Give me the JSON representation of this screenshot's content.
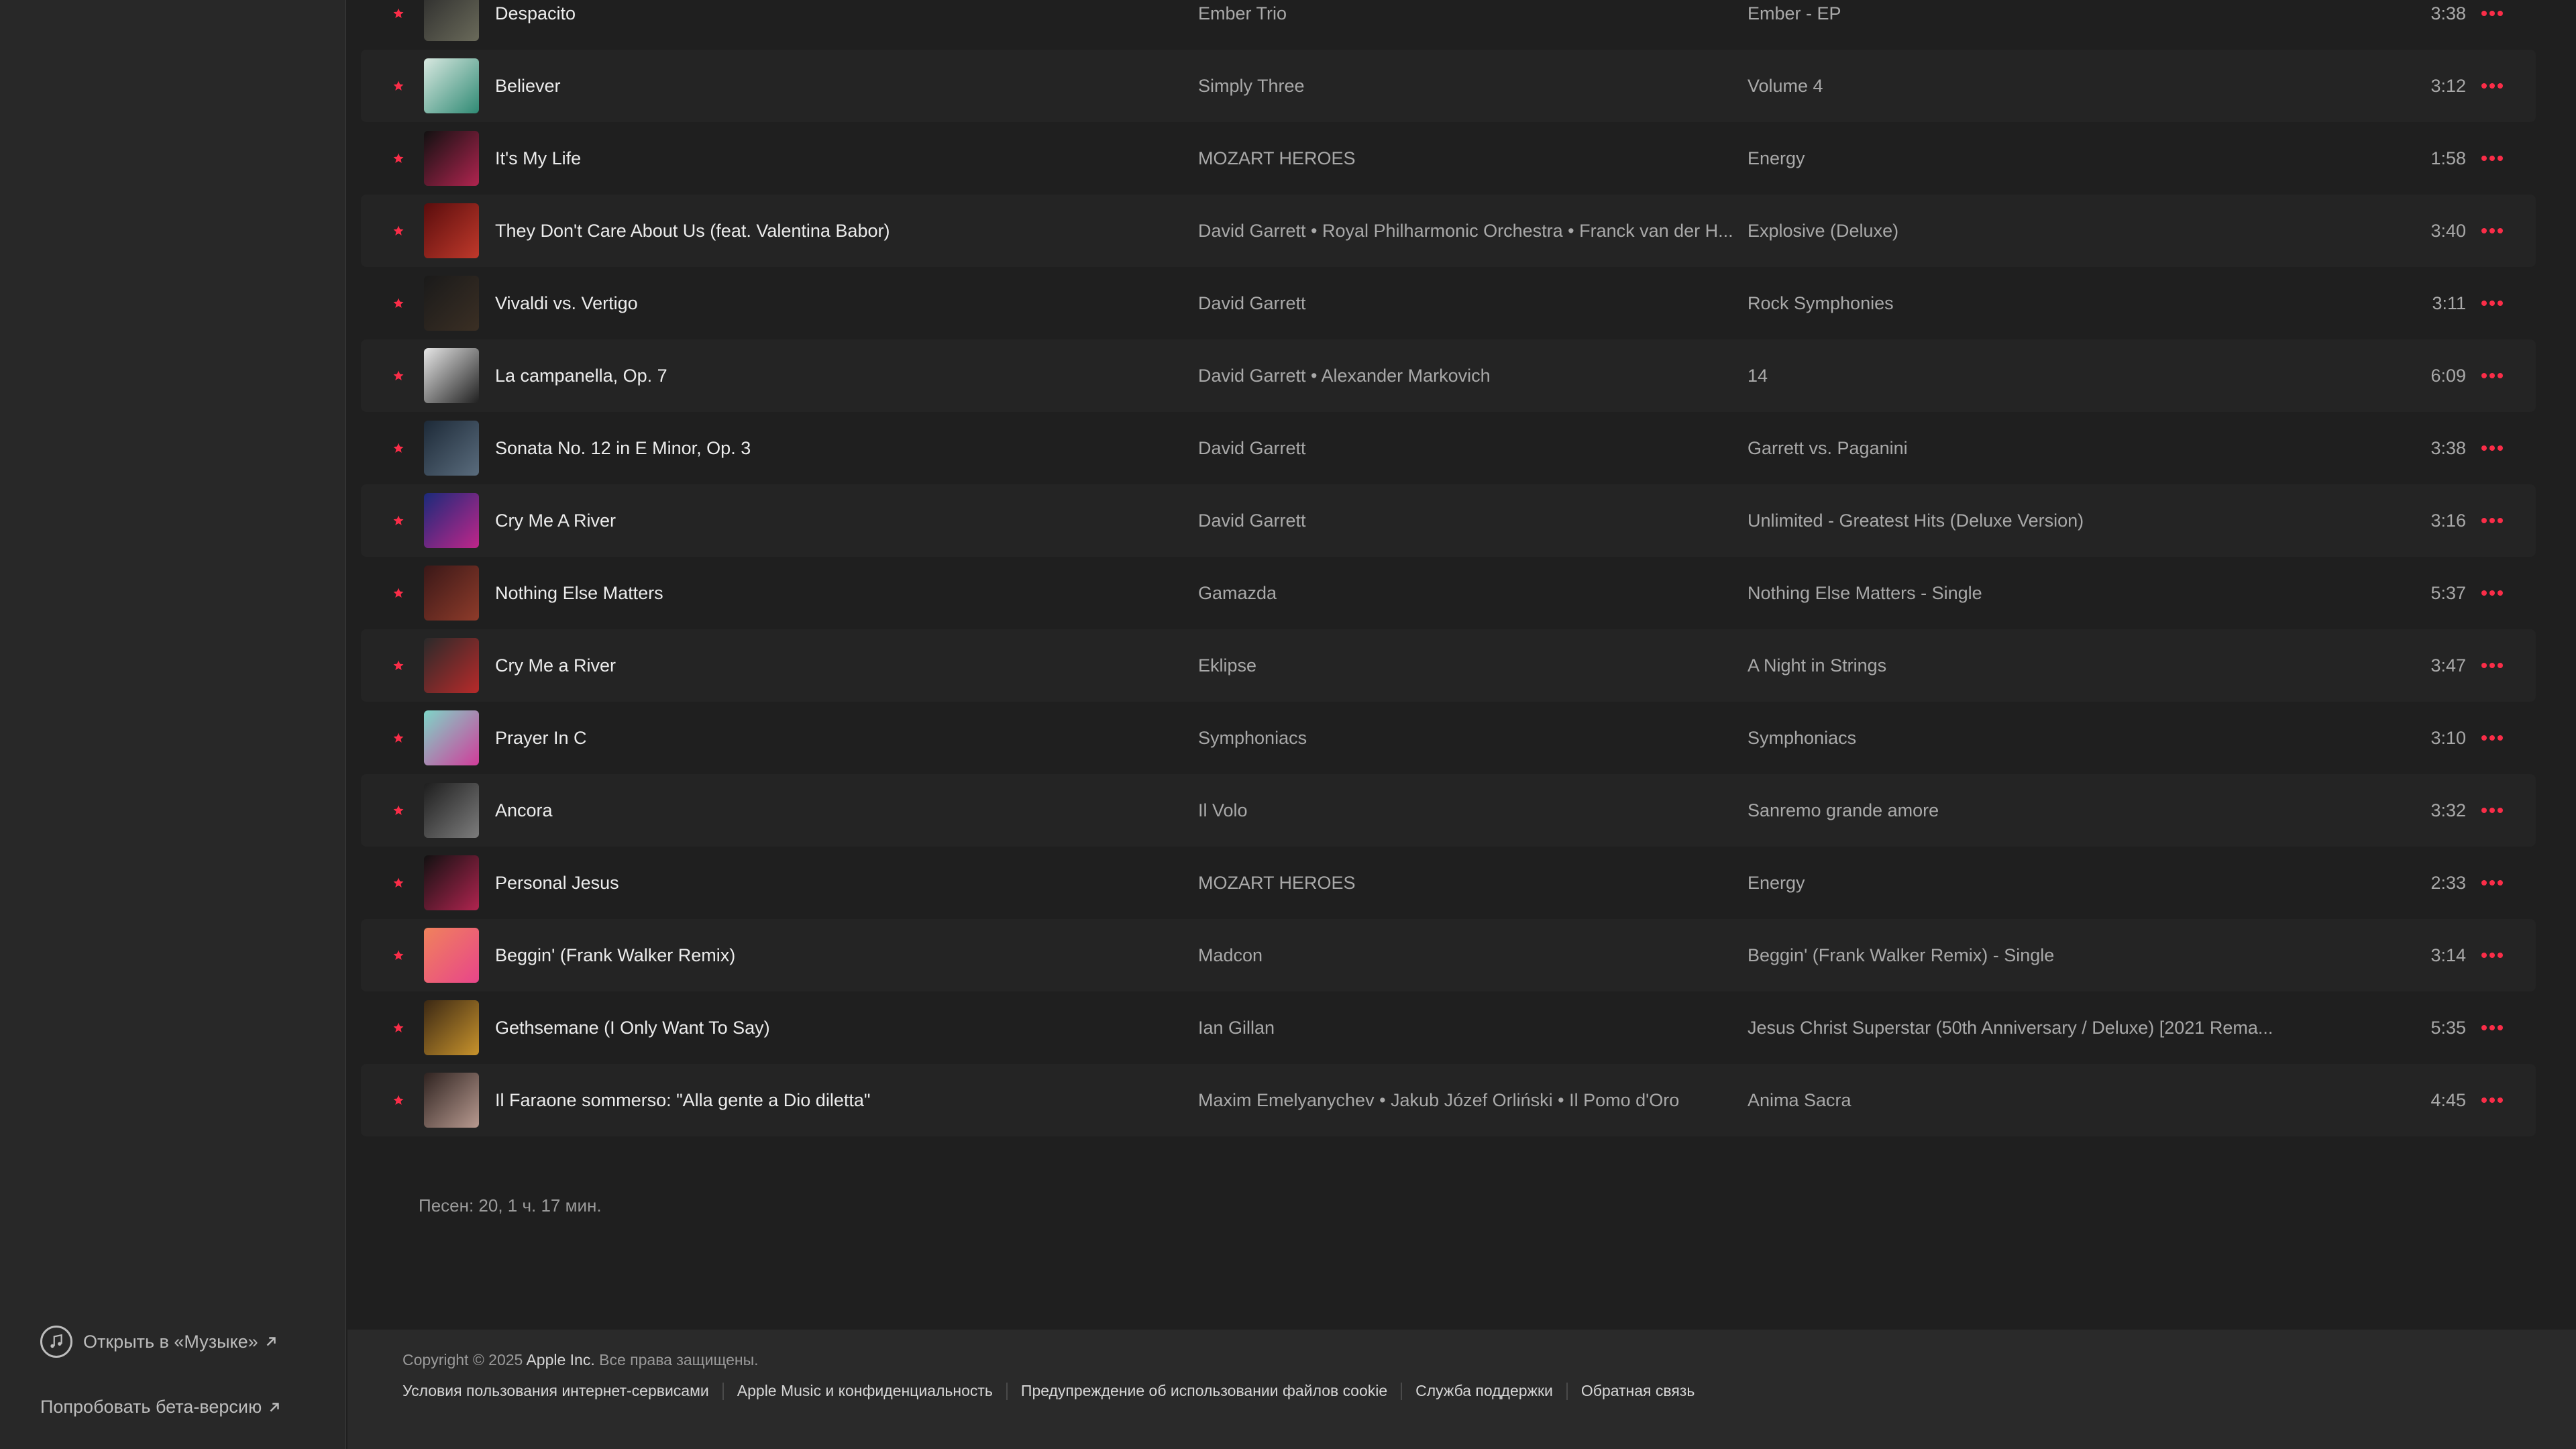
{
  "sidebar": {
    "open_in_music": "Открыть в «Музыке»",
    "try_beta": "Попробовать бета-версию"
  },
  "colors": {
    "accent_star": "#fa2d48",
    "background": "#1f1f1f",
    "sidebar": "#282828"
  },
  "tracks": [
    {
      "title": "Despacito",
      "artist": "Ember Trio",
      "album": "Ember - EP",
      "duration": "3:38",
      "favorite": true
    },
    {
      "title": "Believer",
      "artist": "Simply Three",
      "album": "Volume 4",
      "duration": "3:12",
      "favorite": true
    },
    {
      "title": "It's My Life",
      "artist": "MOZART HEROES",
      "album": "Energy",
      "duration": "1:58",
      "favorite": true
    },
    {
      "title": "They Don't Care About Us (feat. Valentina Babor)",
      "artist": "David Garrett • Royal Philharmonic Orchestra • Franck van der H...",
      "album": "Explosive (Deluxe)",
      "duration": "3:40",
      "favorite": true
    },
    {
      "title": "Vivaldi vs. Vertigo",
      "artist": "David Garrett",
      "album": "Rock Symphonies",
      "duration": "3:11",
      "favorite": true
    },
    {
      "title": "La campanella, Op. 7",
      "artist": "David Garrett • Alexander Markovich",
      "album": "14",
      "duration": "6:09",
      "favorite": true
    },
    {
      "title": "Sonata No. 12 in E Minor, Op. 3",
      "artist": "David Garrett",
      "album": "Garrett vs. Paganini",
      "duration": "3:38",
      "favorite": true
    },
    {
      "title": "Cry Me A River",
      "artist": "David Garrett",
      "album": "Unlimited - Greatest Hits (Deluxe Version)",
      "duration": "3:16",
      "favorite": true
    },
    {
      "title": "Nothing Else Matters",
      "artist": "Gamazda",
      "album": "Nothing Else Matters - Single",
      "duration": "5:37",
      "favorite": true
    },
    {
      "title": "Cry Me a River",
      "artist": "Eklipse",
      "album": "A Night in Strings",
      "duration": "3:47",
      "favorite": true
    },
    {
      "title": "Prayer In C",
      "artist": "Symphoniacs",
      "album": "Symphoniacs",
      "duration": "3:10",
      "favorite": true
    },
    {
      "title": "Ancora",
      "artist": "Il Volo",
      "album": "Sanremo grande amore",
      "duration": "3:32",
      "favorite": true
    },
    {
      "title": "Personal Jesus",
      "artist": "MOZART HEROES",
      "album": "Energy",
      "duration": "2:33",
      "favorite": true
    },
    {
      "title": "Beggin' (Frank Walker Remix)",
      "artist": "Madcon",
      "album": "Beggin' (Frank Walker Remix) - Single",
      "duration": "3:14",
      "favorite": true
    },
    {
      "title": "Gethsemane (I Only Want To Say)",
      "artist": "Ian Gillan",
      "album": "Jesus Christ Superstar (50th Anniversary / Deluxe) [2021 Rema...",
      "duration": "5:35",
      "favorite": true
    },
    {
      "title": "Il Faraone sommerso: \"Alla gente a Dio diletta\"",
      "artist": "Maxim Emelyanychev • Jakub Józef Orliński • Il Pomo d'Oro",
      "album": "Anima Sacra",
      "duration": "4:45",
      "favorite": true
    }
  ],
  "summary": "Песен: 20, 1 ч. 17 мин.",
  "footer": {
    "copyright_prefix": "Copyright © 2025",
    "copyright_company": "Apple Inc.",
    "copyright_suffix": "Все права защищены.",
    "links": [
      "Условия пользования интернет-сервисами",
      "Apple Music и конфиденциальность",
      "Предупреждение об использовании файлов cookie",
      "Служба поддержки",
      "Обратная связь"
    ]
  }
}
